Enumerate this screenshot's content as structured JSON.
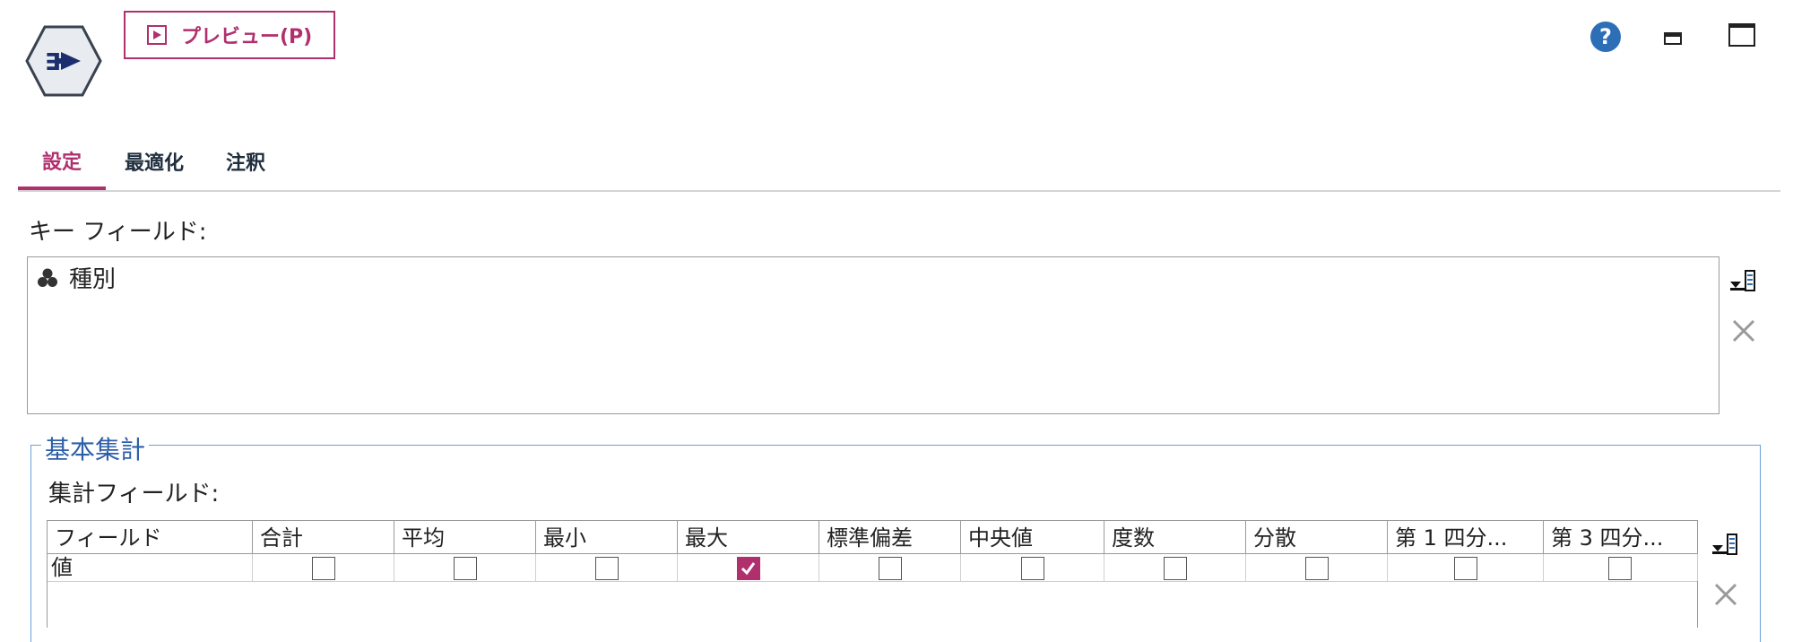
{
  "toolbar": {
    "preview_label": "プレビュー(P)"
  },
  "window_controls": {
    "help_label": "?"
  },
  "tabs": [
    {
      "label": "設定",
      "active": true
    },
    {
      "label": "最適化",
      "active": false
    },
    {
      "label": "注釈",
      "active": false
    }
  ],
  "key_fields": {
    "label": "キー フィールド:",
    "items": [
      "種別"
    ]
  },
  "basic_summary": {
    "title": "基本集計",
    "field_label": "集計フィールド:",
    "columns": [
      "フィールド",
      "合計",
      "平均",
      "最小",
      "最大",
      "標準偏差",
      "中央値",
      "度数",
      "分散",
      "第 1 四分...",
      "第 3 四分..."
    ],
    "rows": [
      {
        "field": "値",
        "checks": [
          false,
          false,
          false,
          true,
          false,
          false,
          false,
          false,
          false,
          false
        ]
      }
    ]
  },
  "colors": {
    "accent": "#b0306e",
    "group_border": "#6a9fd8",
    "group_title": "#2d5fa8",
    "help": "#2d6fb7"
  },
  "icons": {
    "node": "aggregate-node-icon",
    "preview": "play-icon",
    "help": "help-icon",
    "minimize": "minimize-icon",
    "maximize": "maximize-icon",
    "field_type": "set-icon",
    "pick": "field-picker-icon",
    "delete": "delete-icon"
  }
}
